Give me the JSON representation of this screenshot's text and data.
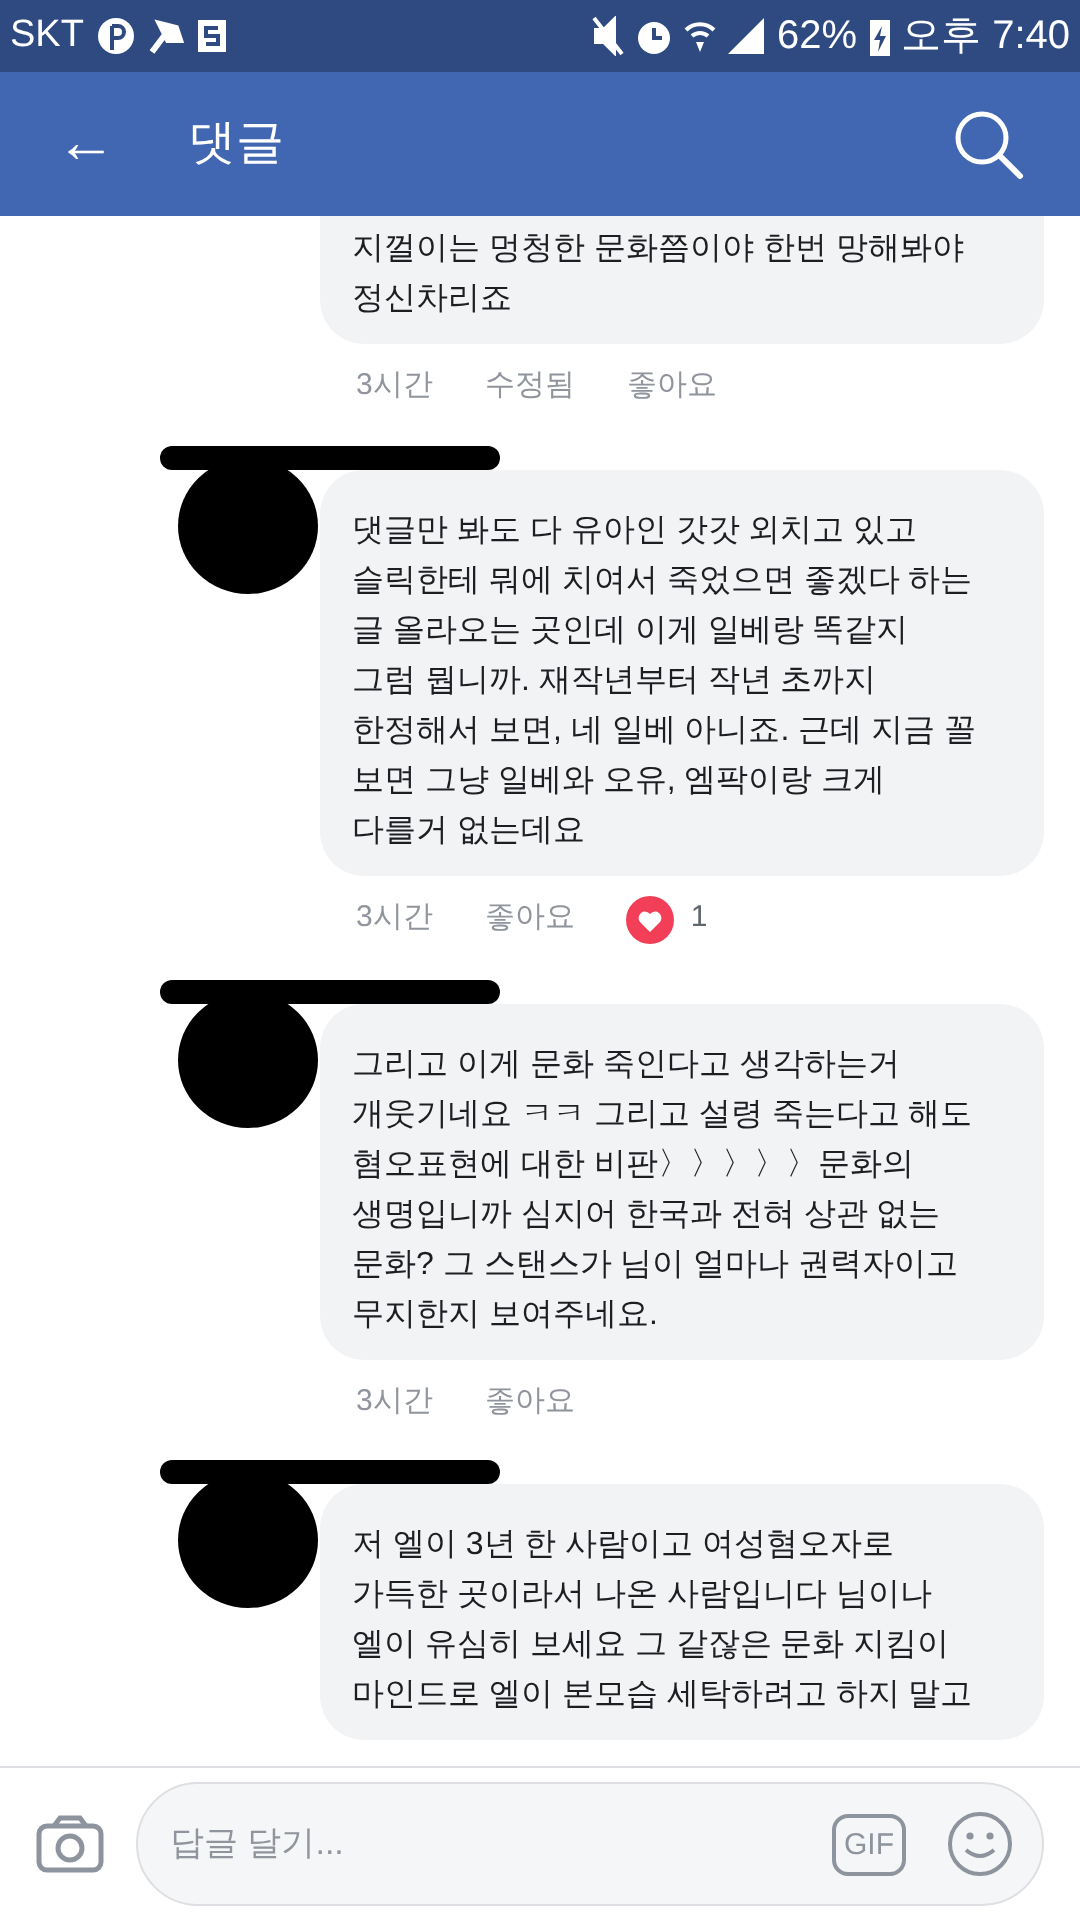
{
  "status_bar": {
    "carrier": "SKT",
    "battery": "62%",
    "time": "오후 7:40"
  },
  "header": {
    "back": "←",
    "title": "댓글"
  },
  "comments": [
    {
      "partial": true,
      "text": "지껄이는 멍청한 문화쯤이야 한번 망해봐야\n정신차리죠",
      "time": "3시간",
      "edited": "수정됨",
      "like": "좋아요"
    },
    {
      "partial": false,
      "text": "댓글만 봐도 다 유아인 갓갓 외치고 있고\n슬릭한테 뭐에 치여서 죽었으면 좋겠다 하는\n글 올라오는 곳인데 이게 일베랑 똑같지\n그럼 뭡니까. 재작년부터 작년 초까지\n한정해서 보면, 네 일베 아니죠. 근데 지금 꼴\n보면 그냥 일베와 오유, 엠팍이랑 크게\n다를거 없는데요",
      "time": "3시간",
      "like": "좋아요",
      "reaction_count": "1"
    },
    {
      "partial": false,
      "text": "그리고 이게 문화 죽인다고 생각하는거\n개웃기네요 ㅋㅋ 그리고 설령 죽는다고 해도\n혐오표현에 대한 비판〉〉〉〉〉문화의\n생명입니까 심지어 한국과 전혀 상관 없는\n문화?  그 스탠스가 님이 얼마나 권력자이고\n무지한지 보여주네요.",
      "time": "3시간",
      "like": "좋아요"
    },
    {
      "partial": false,
      "text": "저 엘이 3년 한 사람이고 여성혐오자로\n가득한 곳이라서 나온 사람입니다 님이나\n엘이 유심히 보세요 그 같잖은 문화 지킴이\n마인드로 엘이 본모습 세탁하려고 하지 말고"
    }
  ],
  "composer": {
    "placeholder": "답글 달기...",
    "gif": "GIF"
  }
}
